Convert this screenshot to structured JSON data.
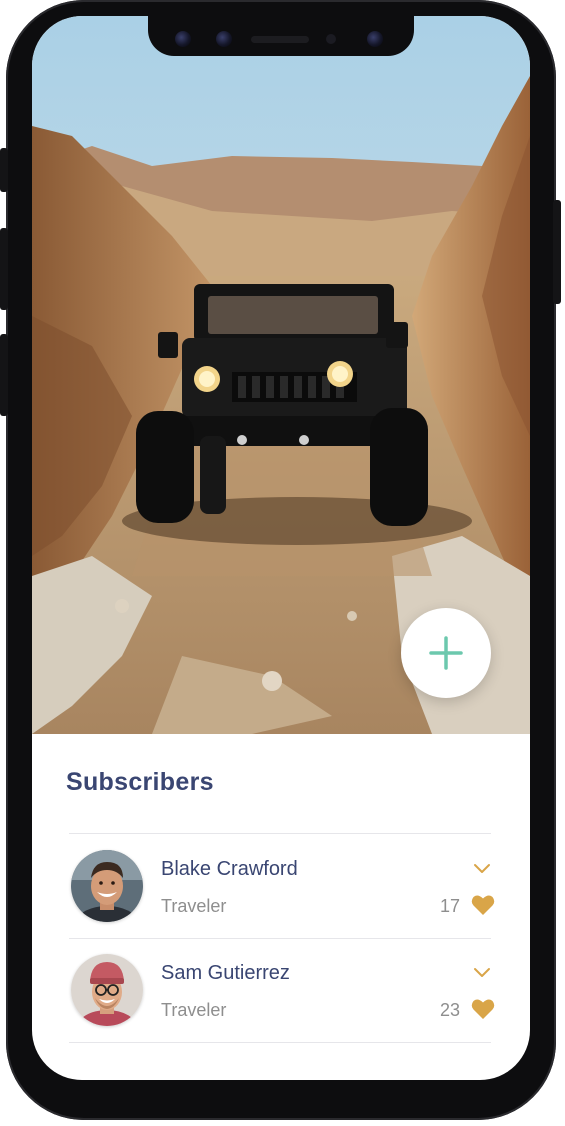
{
  "section": {
    "title": "Subscribers"
  },
  "subscribers": [
    {
      "name": "Blake Crawford",
      "role": "Traveler",
      "likes": "17"
    },
    {
      "name": "Sam Gutierrez",
      "role": "Traveler",
      "likes": "23"
    }
  ],
  "icons": {
    "add": "plus-icon",
    "expand": "chevron-down-icon",
    "like": "heart-icon"
  },
  "colors": {
    "accent": "#6cc8ad",
    "title": "#3a4672",
    "heart": "#d9a548",
    "muted": "#8e8e8e"
  }
}
